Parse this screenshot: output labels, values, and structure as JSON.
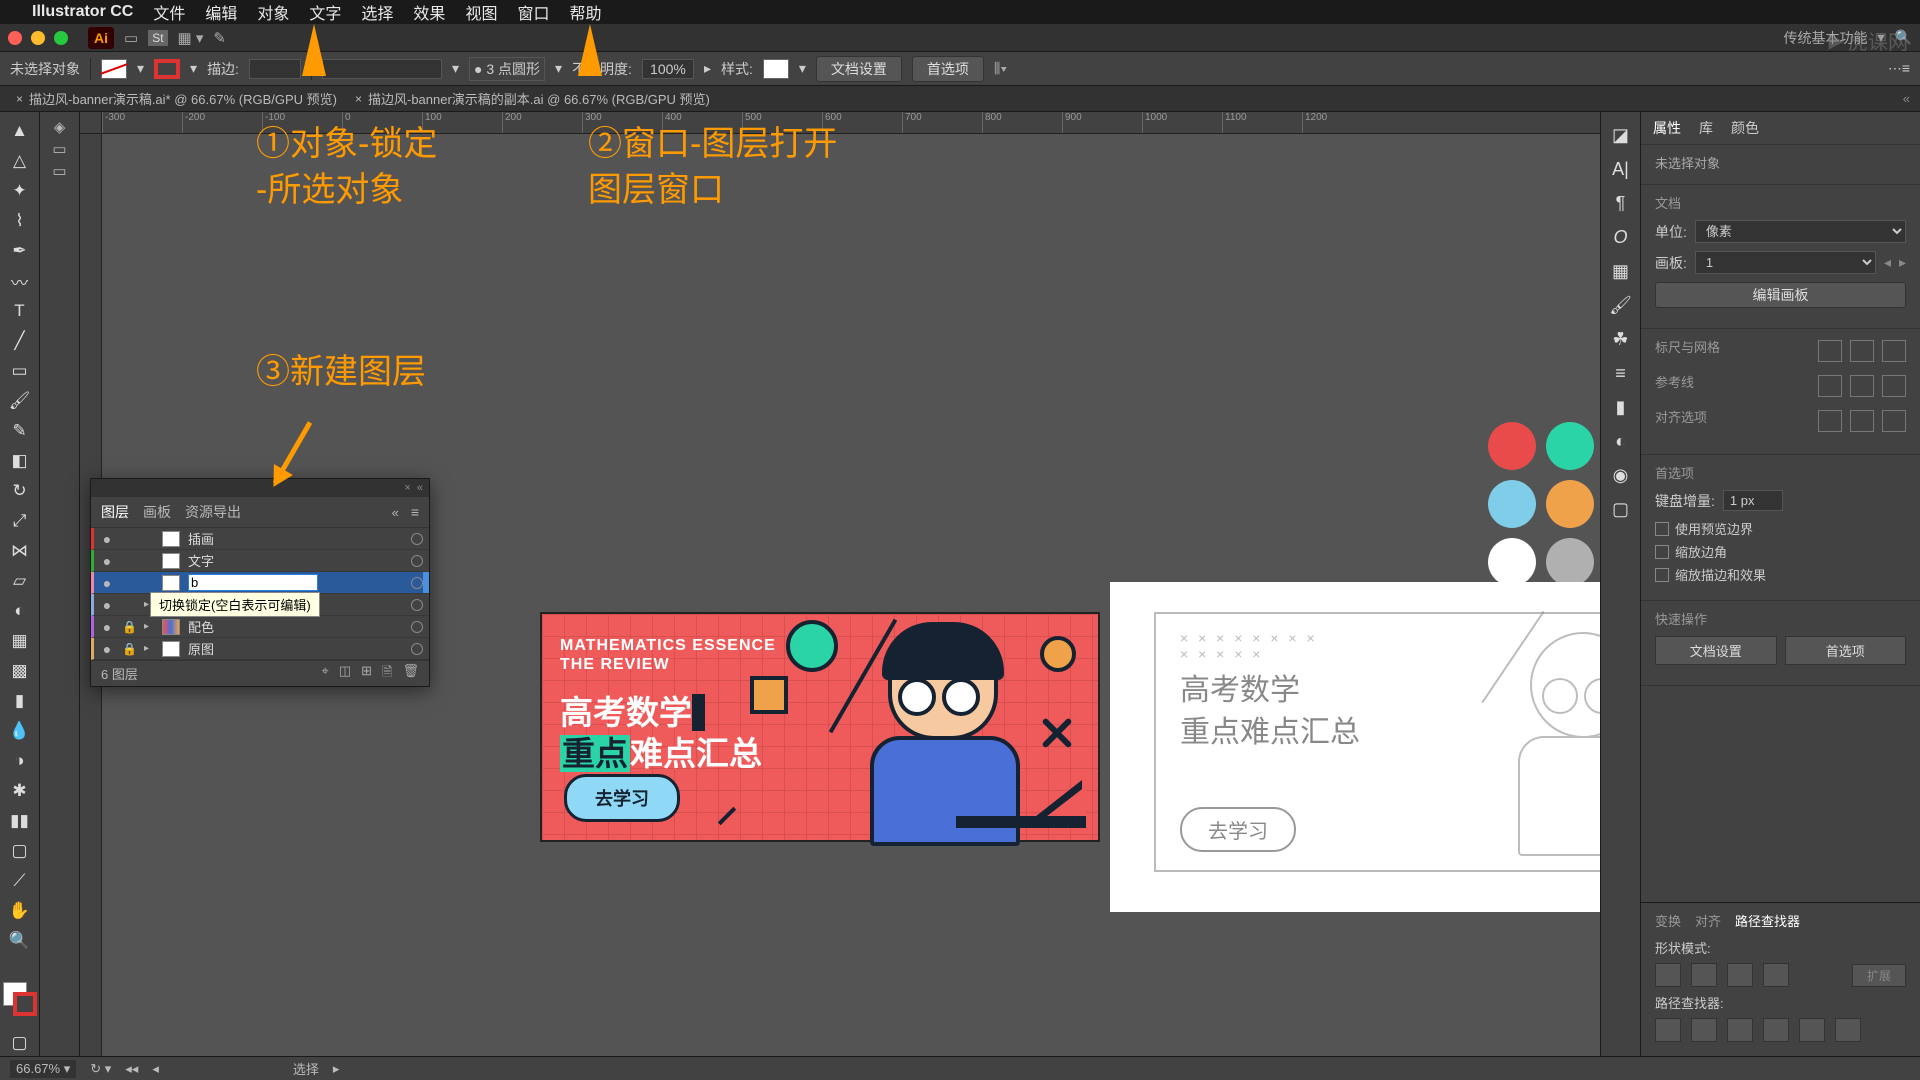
{
  "menu": {
    "app": "Illustrator CC",
    "items": [
      "文件",
      "编辑",
      "对象",
      "文字",
      "选择",
      "效果",
      "视图",
      "窗口",
      "帮助"
    ]
  },
  "chrome": {
    "workspace": "传统基本功能"
  },
  "control": {
    "noSelection": "未选择对象",
    "strokeLabel": "描边:",
    "strokeProfile": "3 点圆形",
    "opacityLabel": "不透明度:",
    "opacityValue": "100%",
    "styleLabel": "样式:",
    "docSetup": "文档设置",
    "prefs": "首选项"
  },
  "tabs": [
    "描边风-banner演示稿.ai* @ 66.67% (RGB/GPU 预览)",
    "描边风-banner演示稿的副本.ai @ 66.67% (RGB/GPU 预览)"
  ],
  "rulerMarks": [
    "-300",
    "-200",
    "-100",
    "0",
    "100",
    "200",
    "300",
    "400",
    "500",
    "600",
    "700",
    "800",
    "900",
    "1000",
    "1100",
    "1200"
  ],
  "banner": {
    "en1": "MATHEMATICS ESSENCE",
    "en2": "THE REVIEW",
    "cn1": "高考数学",
    "cn2a": "重点",
    "cn2b": "难点",
    "cn2c": "汇总",
    "btn": "去学习"
  },
  "sketch": {
    "line1": "高考数学",
    "line2": "重点难点汇总",
    "btn": "去学习"
  },
  "palette": [
    "#e94b4b",
    "#2bd4a6",
    "#4aa8e8",
    "#7fcde8",
    "#efa24a",
    "#f2b8a8",
    "#ffffff",
    "#b0b0b0",
    "#6a6a78"
  ],
  "annotations": {
    "a1l1": "①对象-锁定",
    "a1l2": "-所选对象",
    "a2l1": "②窗口-图层打开",
    "a2l2": "图层窗口",
    "a3": "③新建图层"
  },
  "layers": {
    "tabs": [
      "图层",
      "画板",
      "资源导出"
    ],
    "rows": [
      {
        "name": "插画",
        "eye": "●",
        "lock": "",
        "disc": "",
        "thumb": "plain"
      },
      {
        "name": "文字",
        "eye": "●",
        "lock": "",
        "disc": "",
        "thumb": "plain"
      },
      {
        "name": "",
        "eye": "●",
        "lock": "",
        "disc": "",
        "thumb": "plain",
        "editing": true,
        "value": "b",
        "selected": true
      },
      {
        "name": "",
        "eye": "●",
        "lock": "",
        "disc": "▸",
        "thumb": "multi"
      },
      {
        "name": "配色",
        "eye": "●",
        "lock": "🔒",
        "disc": "▸",
        "thumb": "multi"
      },
      {
        "name": "原图",
        "eye": "●",
        "lock": "🔒",
        "disc": "▸",
        "thumb": "plain"
      }
    ],
    "tooltip": "切换锁定(空白表示可编辑)",
    "footer": "6 图层"
  },
  "props": {
    "tabs": [
      "属性",
      "库",
      "颜色"
    ],
    "noSel": "未选择对象",
    "docHd": "文档",
    "unitLabel": "单位:",
    "unitVal": "像素",
    "artLabel": "画板:",
    "artVal": "1",
    "editArt": "编辑画板",
    "rulerHd": "标尺与网格",
    "guideHd": "参考线",
    "alignHd": "对齐选项",
    "prefHd": "首选项",
    "keyIncLabel": "键盘增量:",
    "keyIncVal": "1 px",
    "usePreview": "使用预览边界",
    "scaleCorner": "缩放边角",
    "scaleStroke": "缩放描边和效果",
    "quickHd": "快速操作",
    "docSetup": "文档设置",
    "prefs": "首选项"
  },
  "pathfinder": {
    "tabs": [
      "变换",
      "对齐",
      "路径查找器"
    ],
    "shapeMode": "形状模式:",
    "expand": "扩展",
    "pfLabel": "路径查找器:"
  },
  "watermark": "虎课网",
  "status": {
    "zoom": "66.67%",
    "tool": "选择"
  }
}
